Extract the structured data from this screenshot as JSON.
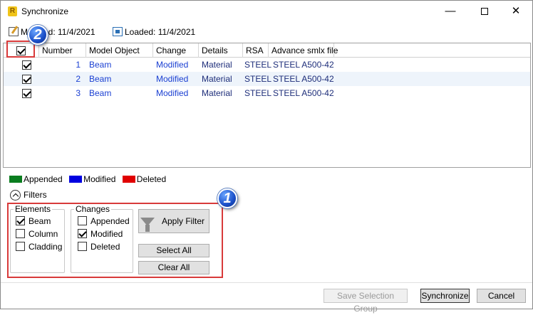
{
  "window": {
    "title": "Synchronize",
    "app_icon_letter": "R",
    "minimize_glyph": "—",
    "close_glyph": "✕"
  },
  "info": {
    "modified": "Modified: 11/4/2021",
    "loaded": "Loaded: 11/4/2021"
  },
  "grid": {
    "columns": [
      "Number",
      "Model Object",
      "Change",
      "Details",
      "RSA",
      "Advance smlx file"
    ],
    "rows": [
      {
        "checked": true,
        "number": "1",
        "model_object": "Beam",
        "change": "Modified",
        "details": "Material",
        "rsa": "STEEL",
        "advance": "STEEL A500-42"
      },
      {
        "checked": true,
        "number": "2",
        "model_object": "Beam",
        "change": "Modified",
        "details": "Material",
        "rsa": "STEEL",
        "advance": "STEEL A500-42"
      },
      {
        "checked": true,
        "number": "3",
        "model_object": "Beam",
        "change": "Modified",
        "details": "Material",
        "rsa": "STEEL",
        "advance": "STEEL A500-42"
      }
    ]
  },
  "legend": [
    {
      "label": "Appended",
      "color": "#0a7d1f"
    },
    {
      "label": "Modified",
      "color": "#0000e0"
    },
    {
      "label": "Deleted",
      "color": "#e00000"
    }
  ],
  "filters": {
    "toggle_label": "Filters",
    "elements": {
      "title": "Elements",
      "options": [
        {
          "label": "Beam",
          "checked": true
        },
        {
          "label": "Column",
          "checked": false
        },
        {
          "label": "Cladding",
          "checked": false
        }
      ]
    },
    "changes": {
      "title": "Changes",
      "options": [
        {
          "label": "Appended",
          "checked": false
        },
        {
          "label": "Modified",
          "checked": true
        },
        {
          "label": "Deleted",
          "checked": false
        }
      ]
    },
    "apply_filter": "Apply Filter",
    "select_all": "Select All",
    "clear_all": "Clear All"
  },
  "callouts": {
    "one": "1",
    "two": "2",
    "color": "#d83a3a"
  },
  "footer": {
    "save_selection_group": "Save Selection Group",
    "synchronize": "Synchronize",
    "cancel": "Cancel"
  }
}
